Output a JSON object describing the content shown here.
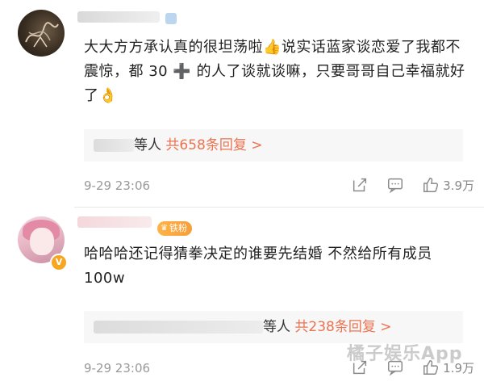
{
  "comments": [
    {
      "text_a": "大大方方承认真的很坦荡啦",
      "text_b": "说实话蓝家谈恋爱了我都不震惊，都 30 ",
      "text_c": " 的人了谈就谈嘛，只要哥哥自己幸福就好了",
      "emoji_thumb": "👍",
      "emoji_plus": "➕",
      "emoji_ok": "👌",
      "replies_suffix": "等人",
      "replies_link": "共658条回复 >",
      "time": "9-29 23:06",
      "likes": "3.9万"
    },
    {
      "text": "哈哈哈还记得猜拳决定的谁要先结婚 不然给所有成员 100w",
      "fan_badge": "铁粉",
      "replies_suffix": "等人",
      "replies_link": "共238条回复 >",
      "time": "9-29 23:06",
      "likes": "1.9万"
    }
  ],
  "watermark": "橘子娱乐App",
  "colors": {
    "link": "#eb7350",
    "meta": "#999999",
    "badge": "#f5a623"
  },
  "icons": [
    "share-icon",
    "comment-icon",
    "like-icon",
    "verified-badge-icon",
    "crown-icon"
  ]
}
